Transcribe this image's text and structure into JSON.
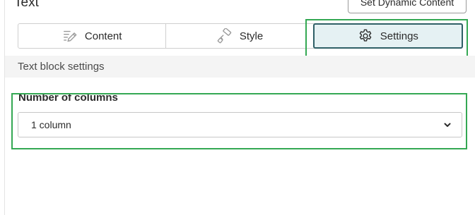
{
  "panel": {
    "title": "Text",
    "dynamic_button": "Set Dynamic Content"
  },
  "tabs": [
    {
      "label": "Content",
      "icon": "edit-lines-icon"
    },
    {
      "label": "Style",
      "icon": "paint-roller-icon"
    },
    {
      "label": "Settings",
      "icon": "gear-icon",
      "active": true
    }
  ],
  "section": {
    "title": "Text block settings"
  },
  "columns_field": {
    "label": "Number of columns",
    "value": "1 column",
    "icon": "chevron-down-icon"
  },
  "colors": {
    "active_tab_bg": "#e5f1f3",
    "active_tab_border": "#2f5f66",
    "highlight_outline": "#34a853"
  }
}
